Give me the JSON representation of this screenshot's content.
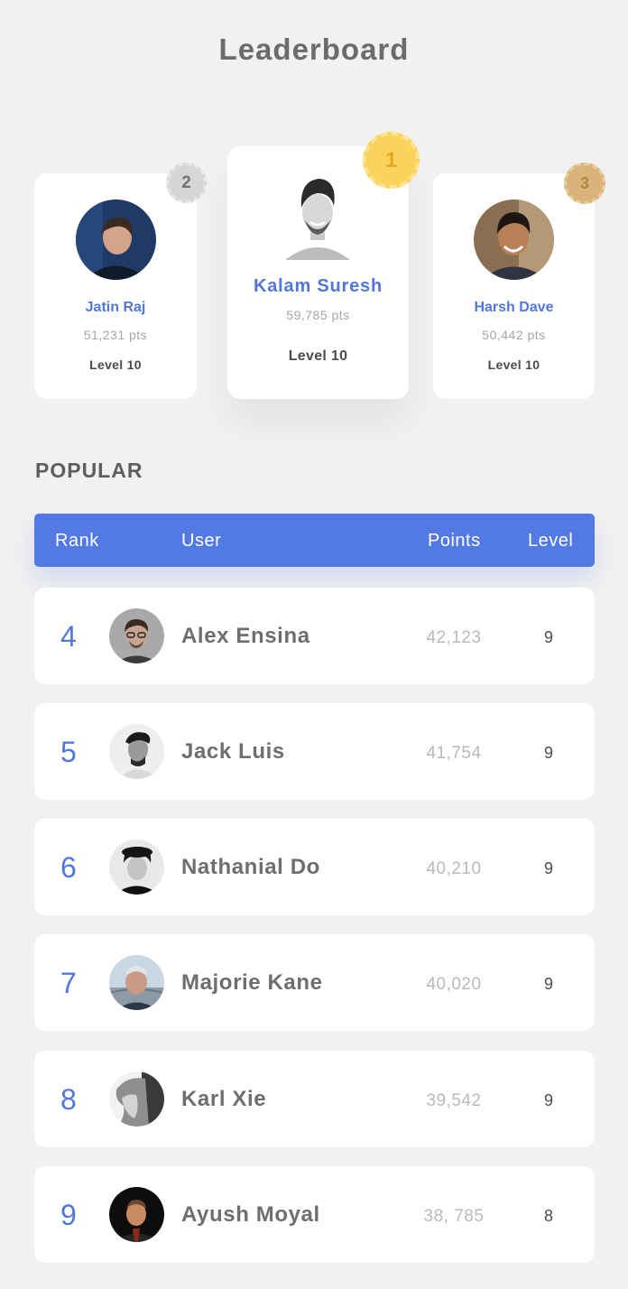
{
  "page": {
    "title": "Leaderboard"
  },
  "podium": [
    {
      "rank": "2",
      "name": "Jatin Raj",
      "points": "51,231 pts",
      "level": "Level 10",
      "badge_color": "#d6d6d6"
    },
    {
      "rank": "1",
      "name": "Kalam Suresh",
      "points": "59,785 pts",
      "level": "Level 10",
      "badge_color": "#fbd25c"
    },
    {
      "rank": "3",
      "name": "Harsh Dave",
      "points": "50,442 pts",
      "level": "Level 10",
      "badge_color": "#d9b47a"
    }
  ],
  "popular": {
    "title": "POPULAR",
    "headers": {
      "rank": "Rank",
      "user": "User",
      "points": "Points",
      "level": "Level"
    },
    "rows": [
      {
        "rank": "4",
        "name": "Alex Ensina",
        "points": "42,123",
        "level": "9"
      },
      {
        "rank": "5",
        "name": "Jack Luis",
        "points": "41,754",
        "level": "9"
      },
      {
        "rank": "6",
        "name": "Nathanial Do",
        "points": "40,210",
        "level": "9"
      },
      {
        "rank": "7",
        "name": "Majorie Kane",
        "points": "40,020",
        "level": "9"
      },
      {
        "rank": "8",
        "name": "Karl Xie",
        "points": "39,542",
        "level": "9"
      },
      {
        "rank": "9",
        "name": "Ayush Moyal",
        "points": "38, 785",
        "level": "8"
      }
    ]
  },
  "colors": {
    "accent": "#5379e4",
    "name_blue": "#5177db",
    "background": "#f1f1f1"
  }
}
